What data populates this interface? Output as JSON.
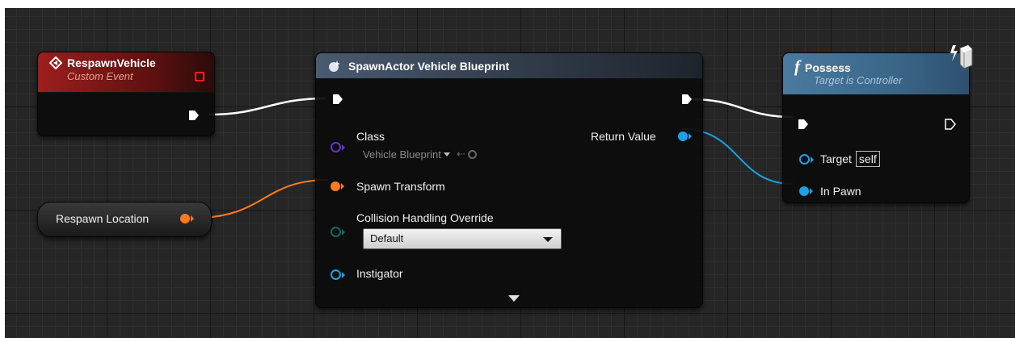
{
  "colors": {
    "event_header": "#8b1a1a",
    "spawn_header": "#3c4a5c",
    "possess_header": "#3c6a8a",
    "exec_wire": "#ffffff",
    "transform_pin": "#ff7a1a",
    "object_pin": "#1aa0e8",
    "class_pin": "#6a2fd0",
    "collision_pin": "#0c6e62"
  },
  "event_node": {
    "icon": "event-diamond-icon",
    "title": "RespawnVehicle",
    "subtitle": "Custom Event"
  },
  "variable_node": {
    "label": "Respawn Location"
  },
  "spawn_node": {
    "icon": "spawn-actor-icon",
    "title": "SpawnActor Vehicle Blueprint",
    "class_label": "Class",
    "class_value": "Vehicle Blueprint",
    "return_label": "Return Value",
    "transform_label": "Spawn Transform",
    "collision_label": "Collision Handling Override",
    "collision_value": "Default",
    "instigator_label": "Instigator",
    "expand_icon": "expand-arrow-icon"
  },
  "possess_node": {
    "function_glyph": "f",
    "title": "Possess",
    "subtitle": "Target is Controller",
    "target_label": "Target",
    "target_value": "self",
    "pawn_label": "In Pawn",
    "icon": "network-replicated-icon"
  }
}
